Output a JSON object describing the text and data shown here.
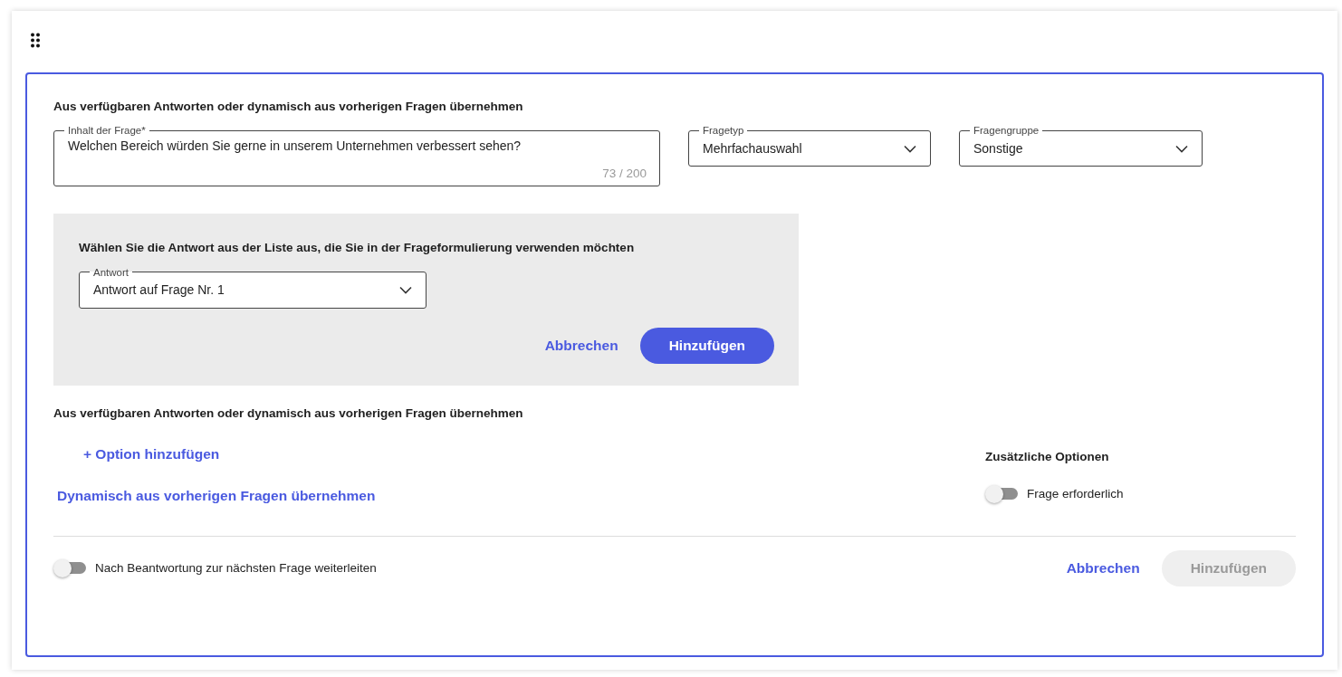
{
  "section_title": "Aus verfügbaren Antworten oder dynamisch aus vorherigen Fragen übernehmen",
  "question_field": {
    "label": "Inhalt der Frage*",
    "value": "Welchen Bereich würden Sie gerne in unserem Unternehmen verbessert sehen?",
    "counter": "73 / 200"
  },
  "selects": [
    {
      "label": "Fragetyp",
      "value": "Mehrfachauswahl"
    },
    {
      "label": "Fragengruppe",
      "value": "Sonstige"
    }
  ],
  "answer_panel": {
    "title": "Wählen Sie die Antwort aus der Liste aus, die Sie in der Frageformulierung verwenden möchten",
    "select": {
      "label": "Antwort",
      "value": "Antwort auf Frage Nr. 1"
    },
    "cancel": "Abbrechen",
    "add": {
      "label": "Hinzufügen",
      "disabled": false
    }
  },
  "options_title": "Aus verfügbaren Antworten oder dynamisch aus vorherigen Fragen übernehmen",
  "add_option": "+ Option hinzufügen",
  "dynamic_link": "Dynamisch aus vorherigen Fragen übernehmen",
  "additional": {
    "title": "Zusätzliche Optionen",
    "toggles": [
      {
        "label": "Frage erforderlich",
        "on": false
      }
    ]
  },
  "footer": {
    "toggle": {
      "label": "Nach Beantwortung zur nächsten Frage weiterleiten",
      "on": false
    },
    "cancel": "Abbrechen",
    "add": {
      "label": "Hinzufügen",
      "disabled": true
    }
  }
}
